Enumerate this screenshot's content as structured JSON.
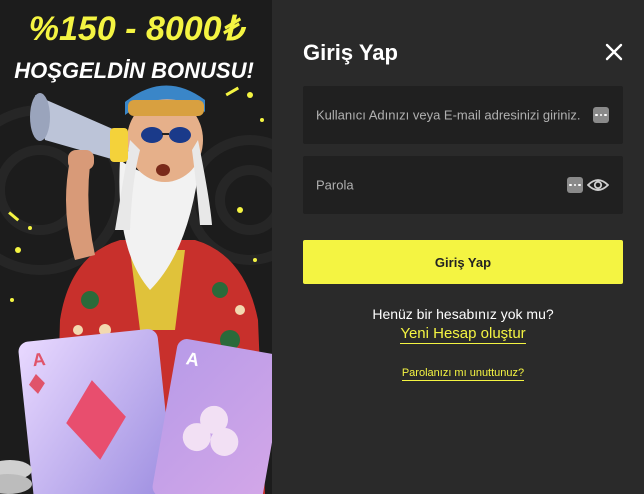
{
  "promo": {
    "headline": "%150 - 8000₺",
    "subheadline": "HOŞGELDİN BONUSU!"
  },
  "login": {
    "title": "Giriş Yap",
    "username_placeholder": "Kullanıcı Adınızı veya E-mail adresinizi giriniz.",
    "password_placeholder": "Parola",
    "submit_label": "Giriş Yap",
    "no_account_text": "Henüz bir hesabınız yok mu?",
    "register_link": "Yeni Hesap oluştur",
    "forgot_link": "Parolanızı mı unuttunuz?"
  },
  "icons": {
    "close": "close-icon",
    "autofill": "password-manager-icon",
    "toggle_visibility": "eye-icon"
  },
  "colors": {
    "accent": "#f4f442",
    "panel_bg": "#2a2a2a",
    "field_bg": "#202020",
    "promo_bg": "#1c1c1c",
    "shirt_red": "#c8302c"
  }
}
